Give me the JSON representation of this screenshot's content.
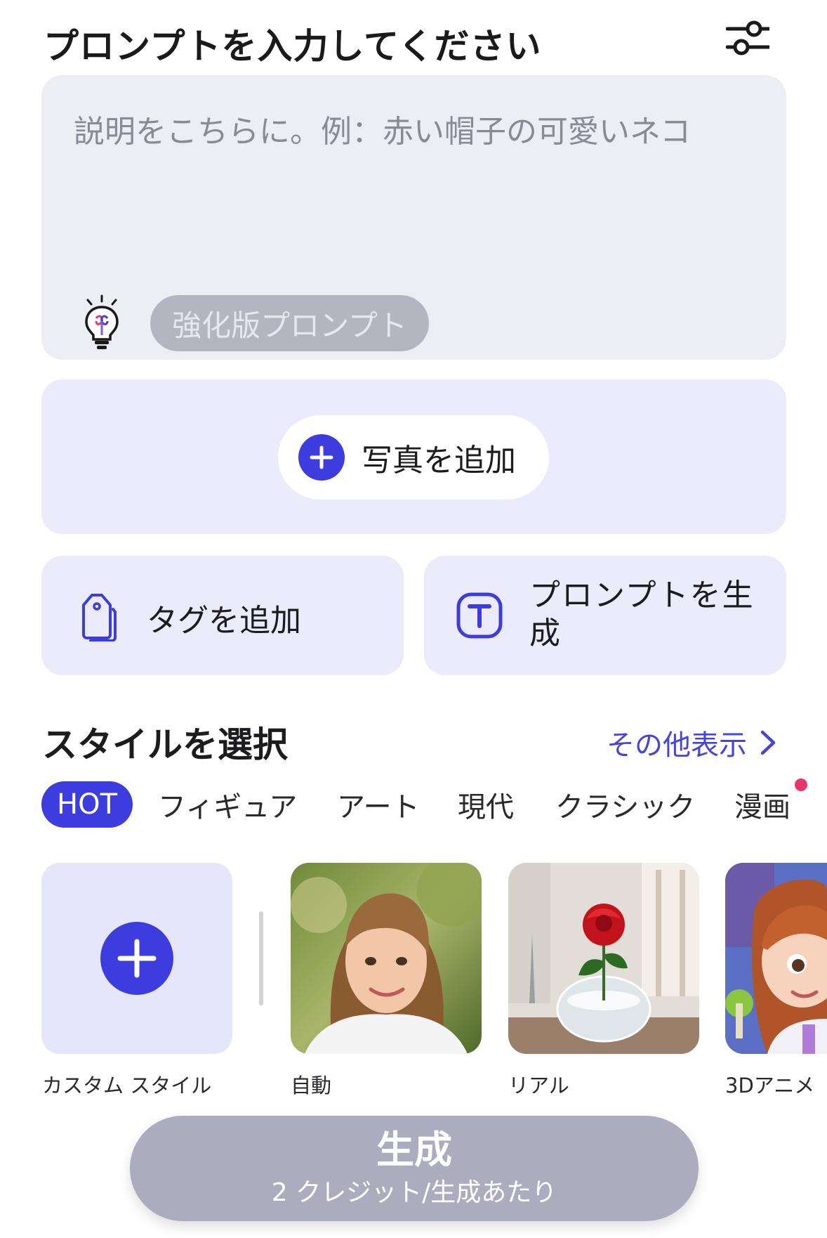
{
  "header": {
    "title": "プロンプトを入力してください",
    "settings_icon": "sliders-icon"
  },
  "prompt": {
    "value": "",
    "placeholder": "説明をこちらに。例：赤い帽子の可愛いネコ",
    "enhance_label": "強化版プロンプト",
    "bulb_icon": "lightbulb-icon"
  },
  "photo": {
    "add_label": "写真を追加"
  },
  "actions": {
    "tag_label": "タグを追加",
    "generate_prompt_label": "プロンプトを生成"
  },
  "styles": {
    "heading": "スタイルを選択",
    "more_label": "その他表示",
    "tabs": [
      "HOT",
      "フィギュア",
      "アート",
      "現代",
      "クラシック",
      "漫画"
    ],
    "active_tab": "HOT",
    "items": [
      "カスタム スタイル",
      "自動",
      "リアル",
      "3Dアニメ"
    ]
  },
  "generate": {
    "label": "生成",
    "cost": "2 クレジット/生成あたり"
  },
  "colors": {
    "accent": "#3d3ddf",
    "link": "#4545d6",
    "surface": "#ebebfb",
    "disabled_button": "#acacbf",
    "notification_dot": "#e8366a"
  }
}
